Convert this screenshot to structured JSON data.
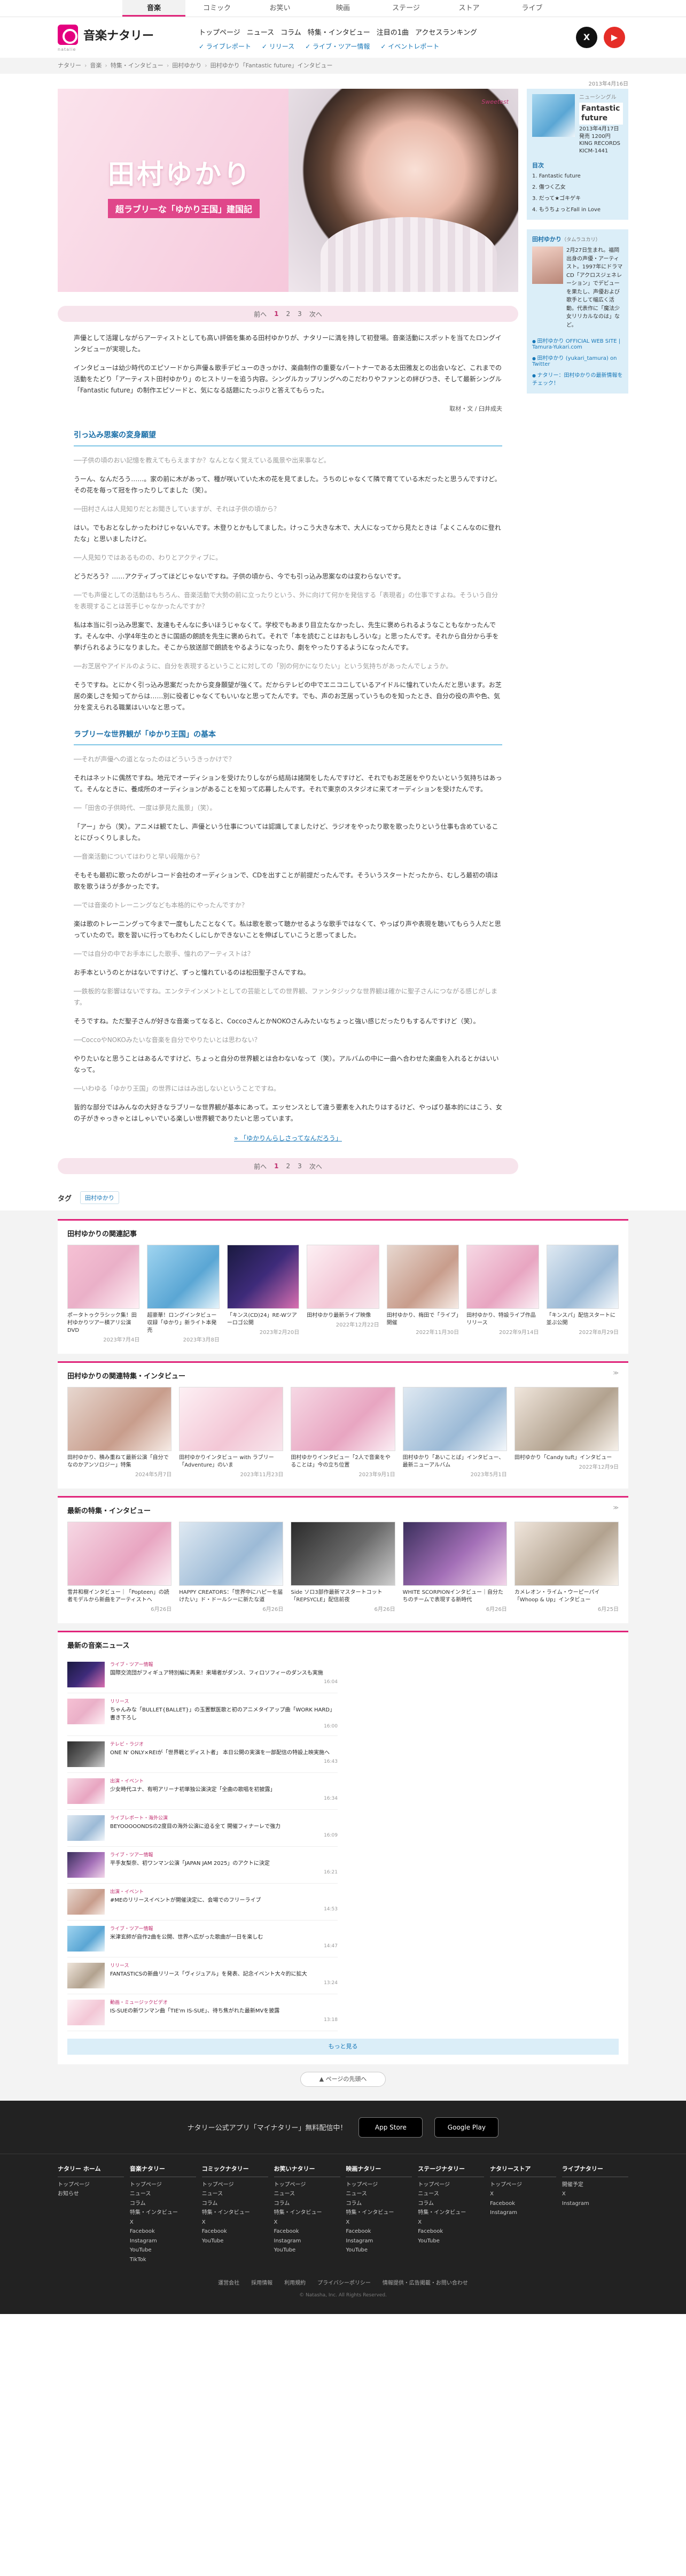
{
  "categories": [
    "音楽",
    "コミック",
    "お笑い",
    "映画",
    "ステージ",
    "ストア",
    "ライブ"
  ],
  "logo": {
    "text": "音楽ナタリー",
    "sub": "natalie"
  },
  "gnav": [
    "トップページ",
    "ニュース",
    "コラム",
    "特集・インタビュー",
    "注目の1曲",
    "アクセスランキング"
  ],
  "snav": [
    "ライブレポート",
    "リリース",
    "ライブ・ツアー情報",
    "イベントレポート"
  ],
  "sns": {
    "x": "X",
    "youtube": "▶"
  },
  "breadcrumb": [
    "ナタリー",
    "音楽",
    "特集・インタビュー",
    "田村ゆかり",
    "田村ゆかり「Fantastic future」インタビュー"
  ],
  "date_top": "2013年4月16日",
  "hero": {
    "brand": "Sweetest",
    "name": "田村ゆかり",
    "subtitle": "超ラブリーな「ゆかり王国」建国記"
  },
  "pager": {
    "prev": "前へ",
    "pages": [
      "1",
      "2",
      "3"
    ],
    "next": "次へ"
  },
  "intro": [
    "声優として活躍しながらアーティストとしても高い評価を集める田村ゆかりが、ナタリーに満を持して初登場。音楽活動にスポットを当てたロングインタビューが実現した。",
    "インタビューは幼少時代のエピソードから声優＆歌手デビューのきっかけ、楽曲制作の重要なパートナーである太田雅友との出会いなど、これまでの活動をたどり「アーティスト田村ゆかり」のヒストリーを追う内容。シングルカップリングへのこだわりやファンとの絆びつき、そして最新シングル「Fantastic future」の制作エピソードと、気になる話題にたっぷりと答えてもらった。"
  ],
  "credit": "取材・文 / 臼井成夫",
  "sections": [
    {
      "title": "引っ込み思案の変身願望",
      "paras": [
        {
          "q": true,
          "text": "──子供の頃のおい記憶を教えてもらえますか？なんとなく覚えている風景や出来事など。"
        },
        {
          "q": false,
          "text": "うーん、なんだろう……。家の前に木があって、種が咲いていた木の花を見てました。うちのじゃなくて隣で育てている木だったと思うんですけど。その花を毎って冠を作ったりしてました（笑）。"
        },
        {
          "q": true,
          "text": "──田村さんは人見知りだとお聞きしていますが、それは子供の頃から？"
        },
        {
          "q": false,
          "text": "はい。でもおとなしかったわけじゃないんです。木登りとかもしてました。けっこう大きな木で、大人になってから見たときは「よくこんなのに登れたな」と思いましたけど。"
        },
        {
          "q": true,
          "text": "──人見知りではあるものの、わりとアクティブに。"
        },
        {
          "q": false,
          "text": "どうだろう？……アクティブってほどじゃないですね。子供の頃から、今でも引っ込み思案なのは変わらないです。"
        },
        {
          "q": true,
          "text": "──でも声優としての活動はもちろん、音楽活動で大勢の前に立ったりという、外に向けて何かを発信する「表現者」の仕事ですよね。そういう自分を表現することは苦手じゃなかったんですか？"
        },
        {
          "q": false,
          "text": "私は本当に引っ込み思案で、友達もそんなに多いほうじゃなくて。学校でもあまり目立たなかったし、先生に褒められるようなこともなかったんです。そんな中、小学4年生のときに国語の朗読を先生に褒められて。それで「本を読むことはおもしろいな」と思ったんです。それから自分から手を挙げられるようになりました。そこから放送部で朗読をやるようになったり、劇をやったりするようになったんです。"
        },
        {
          "q": true,
          "text": "──お芝居やアイドルのように、自分を表現するということに対しての「別の何かになりたい」という気持ちがあったんでしょうか。"
        },
        {
          "q": false,
          "text": "そうですね。とにかく引っ込み思案だったから変身願望が強くて。だからテレビの中でエニコニしているアイドルに憧れていたんだと思います。お芝居の楽しさを知ってからは……別に役者じゃなくてもいいなと思ってたんです。でも、声のお芝居っていうものを知ったとき、自分の役の声や色、気分を変えられる職業はいいなと思って。"
        }
      ]
    },
    {
      "title": "ラブリーな世界観が「ゆかり王国」の基本",
      "paras": [
        {
          "q": true,
          "text": "──それが声優への道となったのはどういうきっかけで？"
        },
        {
          "q": false,
          "text": "それはネットに偶然ですね。地元でオーディションを受けたりしながら結局は諸関をしたんですけど、それでもお芝居をやりたいという気持ちはあって。そんなときに、養成所のオーディションがあることを知って応募したんです。それで東京のスタジオに来てオーディションを受けたんです。"
        },
        {
          "q": true,
          "text": "──「田舎の子供時代、一度は夢見た風景」（笑）。"
        },
        {
          "q": false,
          "text": "「アー」から（笑）。アニメは観てたし、声優という仕事については認識してましたけど、ラジオをやったり歌を歌ったりという仕事も含めていることにびっくりしました。"
        },
        {
          "q": true,
          "text": "──音楽活動についてはわりと早い段階から？"
        },
        {
          "q": false,
          "text": "そもそも最初に歌ったのがレコード会社のオーディションで、CDを出すことが前提だったんです。そういうスタートだったから、むしろ最初の頃は歌を歌うほうが多かったです。"
        },
        {
          "q": true,
          "text": "──では音楽のトレーニングなども本格的にやったんですか？"
        },
        {
          "q": false,
          "text": "楽は歌のトレーニングって今まで一度もしたことなくて。私は歌を歌って聴かせるような歌手ではなくて、やっぱり声や表現を聴いてもらう人だと思っていたので。歌を習いに行ってもわたくしにしかできないことを伸ばしていこうと思ってました。"
        },
        {
          "q": true,
          "text": "──では自分の中でお手本にした歌手、憧れのアーティストは？"
        },
        {
          "q": false,
          "text": "お手本というのとかはないですけど、ずっと憧れているのは松田聖子さんですね。"
        },
        {
          "q": true,
          "text": "──鉄板的な影響はないですね。エンタテインメントとしての芸能としての世界観、ファンタジックな世界観は確かに聖子さんにつながる感じがします。"
        },
        {
          "q": false,
          "text": "そうですね。ただ聖子さんが好きな音楽ってなると、CoccoさんとかNOKOさんみたいなちょっと強い感じだったりもするんですけど（笑）。"
        },
        {
          "q": true,
          "text": "──CoccoやNOKOみたいな音楽を自分でやりたいとは思わない？"
        },
        {
          "q": false,
          "text": "やりたいなと思うことはあるんですけど、ちょっと自分の世界観とは合わないなって（笑）。アルバムの中に一曲へ合わせた楽曲を入れるとかはいいなって。"
        },
        {
          "q": true,
          "text": "──いわゆる「ゆかり王国」の世界にははみ出しないということですね。"
        },
        {
          "q": false,
          "text": "皆的な部分ではみんなの大好きなラブリーな世界観が基本にあって。エッセンスとして違う要素を入れたりはするけど、やっぱり基本的にはこう、女の子がきゃっきゃとはしゃいでいる楽しい世界観でありたいと思っています。"
        }
      ]
    }
  ],
  "next_link": "「ゆかりんらしさってなんだろう」",
  "jacket": {
    "label": "ニューシングル",
    "title": "Fantastic future",
    "info": "2013年4月17日発売 1200円 KING RECORDS KICM-1441"
  },
  "toc": {
    "head": "目次",
    "items": [
      "1. Fantastic future",
      "2. 傷つく乙女",
      "3. だって★ゴキゲキ",
      "4. もうちょっとFall in Love"
    ]
  },
  "profile": {
    "name": "田村ゆかり",
    "kana": "（タムラユカリ）",
    "text": "2月27日生まれ。福岡出身の声優・アーティスト。1997年にドラマCD「アクロスジェネレーション」でデビューを果たし、声優および歌手として幅広く活動。代表作に「魔法少女リリカルなのは」など。",
    "links": [
      "田村ゆかり OFFICIAL WEB SITE | Tamura-Yukari.com",
      "田村ゆかり (yukari_tamura) on Twitter",
      "ナタリー：田村ゆかりの最新情報をチェック！"
    ]
  },
  "tags": {
    "label": "タグ",
    "items": [
      "田村ゆかり"
    ]
  },
  "related": {
    "head": "田村ゆかりの関連記事",
    "items": [
      {
        "title": "ポータトゥクラシック集！田村ゆかりツアー横アリ公演DVD",
        "date": "2023年7月4日"
      },
      {
        "title": "超豪華！ロングインタビュー収録「ゆかり」新ライト本発売",
        "date": "2023年3月8日"
      },
      {
        "title": "「キンス(CD)24」RE-Wツアーロゴ公開",
        "date": "2023年2月20日"
      },
      {
        "title": "田村ゆかり最新ライブ映像",
        "date": "2022年12月22日"
      },
      {
        "title": "田村ゆかり、梅田で「ライブ」開催",
        "date": "2022年11月30日"
      },
      {
        "title": "田村ゆかり、特設ライブ作品リリース",
        "date": "2022年9月14日"
      },
      {
        "title": "「キンスパ」配信スタートに並ぶ公開",
        "date": "2022年8月29日"
      }
    ]
  },
  "interviews": {
    "head": "田村ゆかりの関連特集・インタビュー",
    "more": "≫",
    "items": [
      {
        "title": "田村ゆかり、積み重ねて最新公演「自分でなのかアンソロジー」特集",
        "date": "2024年5月7日"
      },
      {
        "title": "田村ゆかりインタビュー with ラブリー「Adventure」のいま",
        "date": "2023年11月23日"
      },
      {
        "title": "田村ゆかりインタビュー「2人で音楽をやることは」今の立ち位置",
        "date": "2023年9月1日"
      },
      {
        "title": "田村ゆかり「あいことば」インタビュー、最新ニューアルバム",
        "date": "2023年5月1日"
      },
      {
        "title": "田村ゆかり「Candy tuft」インタビュー",
        "date": "2022年12月9日"
      }
    ]
  },
  "latest_features": {
    "head": "最新の特集・インタビュー",
    "more": "≫",
    "items": [
      {
        "title": "雪井和樹インタビュー｜「Popteen」の読者モデルから新曲をアーティストへ",
        "date": "6月26日"
      },
      {
        "title": "HAPPY CREATORS：「世界中にハピーを届けたい」ド・ドールシーに新たな道",
        "date": "6月26日"
      },
      {
        "title": "Side ソロ3部作最新マスタートコット「REPSYCLE」配信前夜",
        "date": "6月26日"
      },
      {
        "title": "WHITE SCORPIONインタビュー｜自分たちのチームで表現する新時代",
        "date": "6月26日"
      },
      {
        "title": "カメレオン・ライム・ウーピーパイ「Whoop & Up」インタビュー",
        "date": "6月25日"
      }
    ]
  },
  "latest_news": {
    "head": "最新の音楽ニュース",
    "more_label": "もっと見る",
    "items": [
      {
        "cat": "ライブ・ツアー情報",
        "title": "国際交流団がフィギュア特別編に再来！来場者がダンス、フィロソフィーのダンスも実施",
        "meta": "16:04"
      },
      {
        "cat": "リリース",
        "title": "ちゃんみな「BULLET{BALLET}」の玉置獣医歌と初のアニメタイアップ曲「WORK HARD」書き下ろし",
        "meta": "16:00"
      },
      {
        "cat": "テレビ・ラジオ",
        "title": "ONE N' ONLY×REIが「世界戦とディス卜者」 本日公開の実演を一部配信の特設上映実施へ",
        "meta": "16:43"
      },
      {
        "cat": "出演・イベント",
        "title": "少女時代ユナ、有明アリーナ初単独公演決定「全曲の歌唱を初披露」",
        "meta": "16:34"
      },
      {
        "cat": "ライブレポート・海外公演",
        "title": "BEYOOOOONDSの2度目の海外公演に迫る全て 開催フィナーレで強力",
        "meta": "16:09"
      },
      {
        "cat": "ライブ・ツアー情報",
        "title": "平手友梨奈、初ワンマン公演「JAPAN JAM 2025」のアクトに決定",
        "meta": "16:21"
      },
      {
        "cat": "出演・イベント",
        "title": "#MEのリリースイベントが開催決定に、会場でのフリーライブ",
        "meta": "14:53"
      },
      {
        "cat": "ライブ・ツアー情報",
        "title": "米津玄師が自作2曲を公開、世界へ広がった歌曲が一日を楽しむ",
        "meta": "14:47"
      },
      {
        "cat": "リリース",
        "title": "FANTASTICSの新曲リリース「ヴィジュアル」を発表、記念イベント大々的に拡大",
        "meta": "13:24"
      },
      {
        "cat": "動画・ミュージックビデオ",
        "title": "IS-SUEの新ワンマン曲「TIE'm IS-SUE」、待ち焦がれた最新MVを披露",
        "meta": "13:18"
      }
    ]
  },
  "to_top": "ページの先頭へ",
  "footer": {
    "app_text": "ナタリー公式アプリ「マイナタリー」無料配信中！",
    "app_store": "App Store",
    "google_play": "Google Play",
    "cols": [
      {
        "head": "ナタリー ホーム",
        "items": [
          "トップページ",
          "お知らせ"
        ]
      },
      {
        "head": "音楽ナタリー",
        "items": [
          "トップページ",
          "ニュース",
          "コラム",
          "特集・インタビュー",
          "X",
          "Facebook",
          "Instagram",
          "YouTube",
          "TikTok"
        ]
      },
      {
        "head": "コミックナタリー",
        "items": [
          "トップページ",
          "ニュース",
          "コラム",
          "特集・インタビュー",
          "X",
          "Facebook",
          "YouTube"
        ]
      },
      {
        "head": "お笑いナタリー",
        "items": [
          "トップページ",
          "ニュース",
          "コラム",
          "特集・インタビュー",
          "X",
          "Facebook",
          "Instagram",
          "YouTube"
        ]
      },
      {
        "head": "映画ナタリー",
        "items": [
          "トップページ",
          "ニュース",
          "コラム",
          "特集・インタビュー",
          "X",
          "Facebook",
          "Instagram",
          "YouTube"
        ]
      },
      {
        "head": "ステージナタリー",
        "items": [
          "トップページ",
          "ニュース",
          "コラム",
          "特集・インタビュー",
          "X",
          "Facebook",
          "YouTube"
        ]
      },
      {
        "head": "ナタリーストア",
        "items": [
          "トップページ",
          "X",
          "Facebook",
          "Instagram"
        ]
      },
      {
        "head": "ライブナタリー",
        "items": [
          "開催予定",
          "X",
          "Instagram"
        ]
      }
    ],
    "links": [
      "運営会社",
      "採用情報",
      "利用規約",
      "プライバシーポリシー",
      "情報提供・広告掲載・お問い合わせ"
    ],
    "copyright": "© Natasha, Inc. All Rights Reserved."
  }
}
